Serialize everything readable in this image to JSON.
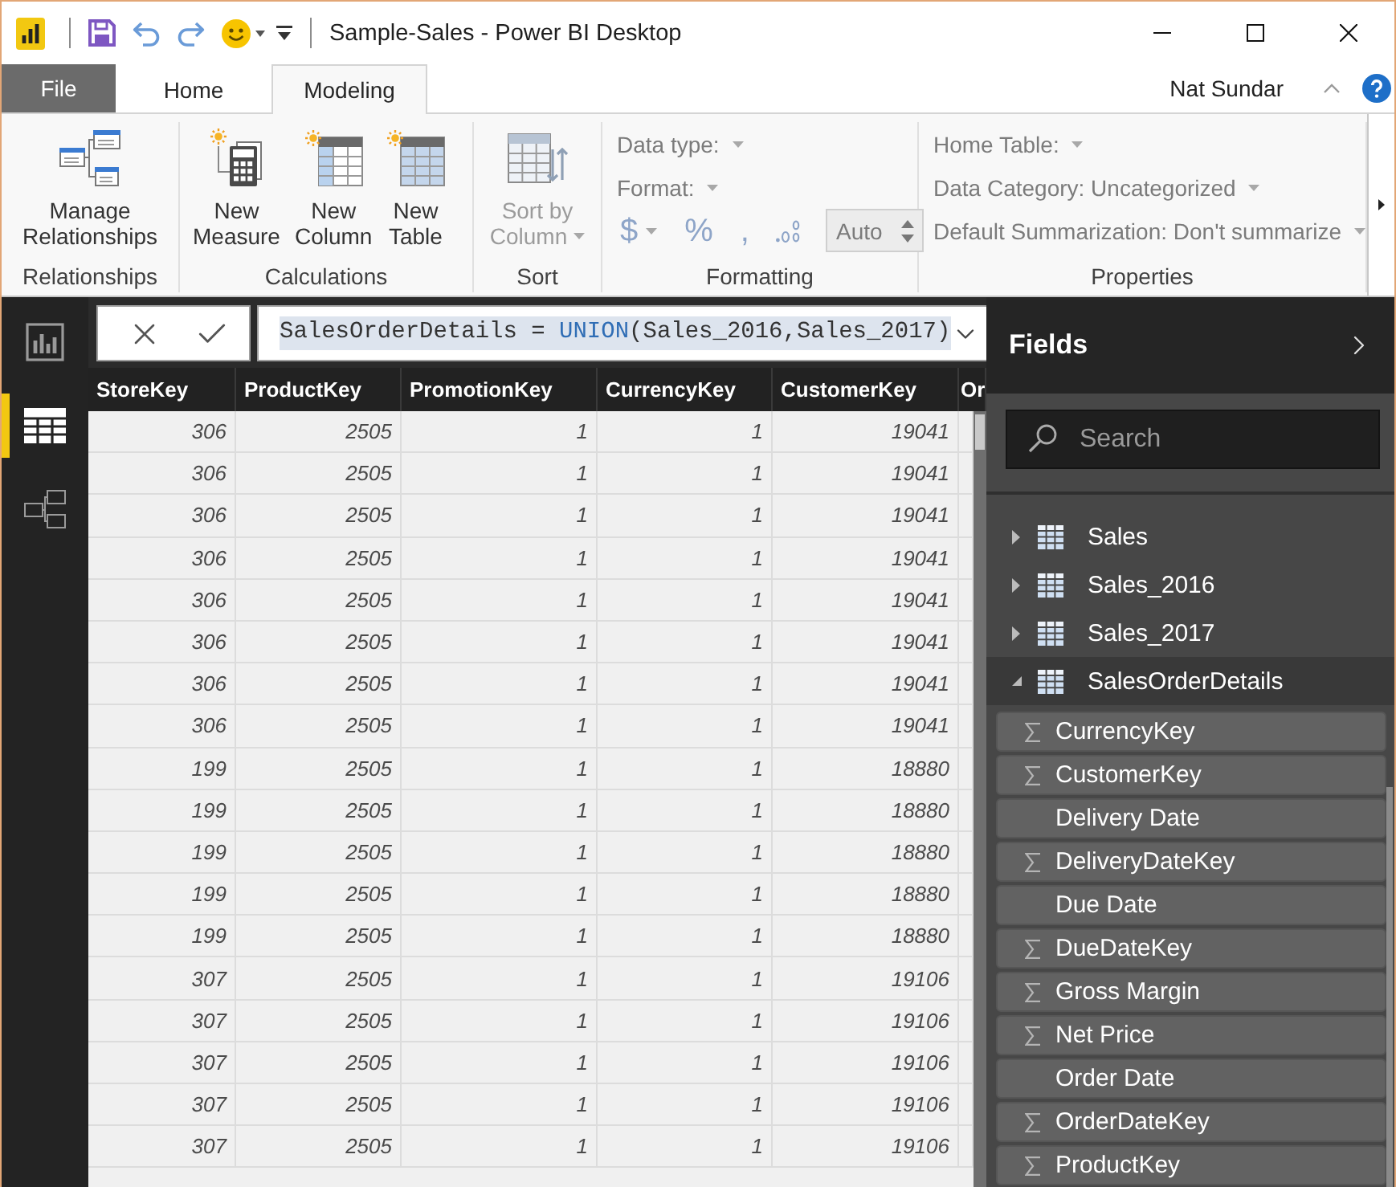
{
  "window": {
    "title": "Sample-Sales - Power BI Desktop"
  },
  "tabs": [
    {
      "label": "File",
      "kind": "file",
      "selected": false
    },
    {
      "label": "Home",
      "kind": "tab",
      "selected": false
    },
    {
      "label": "Modeling",
      "kind": "tab",
      "selected": true
    }
  ],
  "user": {
    "name": "Nat Sundar"
  },
  "ribbon": {
    "groups": [
      {
        "label": "Relationships",
        "buttons": [
          {
            "lines": [
              "Manage",
              "Relationships"
            ],
            "kind": "relationships",
            "disabled": false
          }
        ]
      },
      {
        "label": "Calculations",
        "buttons": [
          {
            "lines": [
              "New",
              "Measure"
            ],
            "kind": "measure",
            "disabled": false
          },
          {
            "lines": [
              "New",
              "Column"
            ],
            "kind": "column",
            "disabled": false
          },
          {
            "lines": [
              "New",
              "Table"
            ],
            "kind": "table",
            "disabled": false
          }
        ]
      },
      {
        "label": "Sort",
        "buttons": [
          {
            "lines": [
              "Sort by",
              "Column"
            ],
            "kind": "sort",
            "disabled": true,
            "dropdown": true
          }
        ]
      },
      {
        "label": "Formatting",
        "dropdowns": [
          {
            "label": "Data type:",
            "disabled": true
          },
          {
            "label": "Format:",
            "disabled": true
          }
        ],
        "tools": [
          {
            "kind": "symbol",
            "label": "$",
            "dropdown": true,
            "disabled": true
          },
          {
            "kind": "symbol",
            "label": "%",
            "disabled": true
          },
          {
            "kind": "symbol",
            "label": ",",
            "disabled": true
          },
          {
            "kind": "decimal",
            "disabled": true
          }
        ],
        "spinner": {
          "value": "Auto",
          "disabled": true
        }
      },
      {
        "label": "Properties",
        "dropdowns": [
          {
            "label": "Home Table:",
            "disabled": true
          },
          {
            "label": "Data Category: Uncategorized",
            "disabled": true
          },
          {
            "label": "Default Summarization: Don't summarize",
            "disabled": true
          }
        ]
      }
    ]
  },
  "views": [
    {
      "kind": "report",
      "selected": false
    },
    {
      "kind": "data",
      "selected": true
    },
    {
      "kind": "model",
      "selected": false
    }
  ],
  "formula_bar": {
    "selected": true,
    "parts": [
      {
        "kind": "plain",
        "text": "SalesOrderDetails = "
      },
      {
        "kind": "function",
        "text": "UNION"
      },
      {
        "kind": "plain",
        "text": "(Sales_2016,Sales_2017)"
      }
    ]
  },
  "table": {
    "columns": [
      "StoreKey",
      "ProductKey",
      "PromotionKey",
      "CurrencyKey",
      "CustomerKey",
      "Or"
    ],
    "rows": [
      [
        "306",
        "2505",
        "1",
        "1",
        "19041"
      ],
      [
        "306",
        "2505",
        "1",
        "1",
        "19041"
      ],
      [
        "306",
        "2505",
        "1",
        "1",
        "19041"
      ],
      [
        "306",
        "2505",
        "1",
        "1",
        "19041"
      ],
      [
        "306",
        "2505",
        "1",
        "1",
        "19041"
      ],
      [
        "306",
        "2505",
        "1",
        "1",
        "19041"
      ],
      [
        "306",
        "2505",
        "1",
        "1",
        "19041"
      ],
      [
        "306",
        "2505",
        "1",
        "1",
        "19041"
      ],
      [
        "199",
        "2505",
        "1",
        "1",
        "18880"
      ],
      [
        "199",
        "2505",
        "1",
        "1",
        "18880"
      ],
      [
        "199",
        "2505",
        "1",
        "1",
        "18880"
      ],
      [
        "199",
        "2505",
        "1",
        "1",
        "18880"
      ],
      [
        "199",
        "2505",
        "1",
        "1",
        "18880"
      ],
      [
        "307",
        "2505",
        "1",
        "1",
        "19106"
      ],
      [
        "307",
        "2505",
        "1",
        "1",
        "19106"
      ],
      [
        "307",
        "2505",
        "1",
        "1",
        "19106"
      ],
      [
        "307",
        "2505",
        "1",
        "1",
        "19106"
      ],
      [
        "307",
        "2505",
        "1",
        "1",
        "19106"
      ]
    ]
  },
  "fields_pane": {
    "title": "Fields",
    "search": {
      "placeholder": "Search"
    },
    "tables": [
      {
        "name": "Sales",
        "expanded": false
      },
      {
        "name": "Sales_2016",
        "expanded": false
      },
      {
        "name": "Sales_2017",
        "expanded": false
      },
      {
        "name": "SalesOrderDetails",
        "expanded": true,
        "children": [
          {
            "name": "CurrencyKey",
            "kind": "numeric"
          },
          {
            "name": "CustomerKey",
            "kind": "numeric"
          },
          {
            "name": "Delivery Date",
            "kind": "date"
          },
          {
            "name": "DeliveryDateKey",
            "kind": "numeric"
          },
          {
            "name": "Due Date",
            "kind": "date"
          },
          {
            "name": "DueDateKey",
            "kind": "numeric"
          },
          {
            "name": "Gross Margin",
            "kind": "numeric"
          },
          {
            "name": "Net Price",
            "kind": "numeric"
          },
          {
            "name": "Order Date",
            "kind": "date"
          },
          {
            "name": "OrderDateKey",
            "kind": "numeric"
          },
          {
            "name": "ProductKey",
            "kind": "numeric"
          }
        ]
      }
    ]
  }
}
